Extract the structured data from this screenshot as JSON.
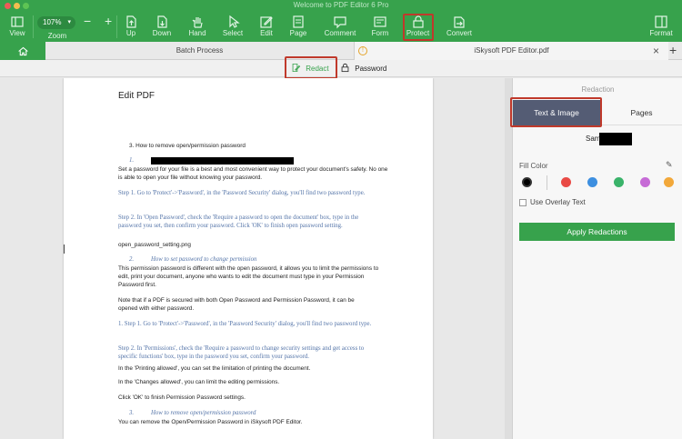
{
  "window": {
    "title": "Welcome to PDF Editor 6 Pro"
  },
  "toolbar": {
    "zoom_value": "107%",
    "zoom_minus": "−",
    "zoom_plus": "+",
    "items": [
      {
        "label": "View",
        "icon": "sidebar-icon"
      },
      {
        "label": "Zoom",
        "icon": "zoom-icon"
      },
      {
        "label": "Up",
        "icon": "page-up-icon"
      },
      {
        "label": "Down",
        "icon": "page-down-icon"
      },
      {
        "label": "Hand",
        "icon": "hand-icon"
      },
      {
        "label": "Select",
        "icon": "cursor-icon"
      },
      {
        "label": "Edit",
        "icon": "edit-icon"
      },
      {
        "label": "Page",
        "icon": "page-icon"
      },
      {
        "label": "Comment",
        "icon": "comment-icon"
      },
      {
        "label": "Form",
        "icon": "form-icon"
      },
      {
        "label": "Protect",
        "icon": "protect-icon"
      },
      {
        "label": "Convert",
        "icon": "convert-icon"
      },
      {
        "label": "Format",
        "icon": "format-icon"
      }
    ],
    "active": "Protect"
  },
  "tabs": {
    "batch": "Batch Process",
    "file": "iSkysoft PDF Editor.pdf",
    "warn": "!",
    "close": "×",
    "add": "+"
  },
  "subtoolbar": {
    "redact": "Redact",
    "password": "Password"
  },
  "document": {
    "heading": "Edit PDF",
    "list_item": "3.    How to remove open/permission password",
    "num1": "1.",
    "p1": "Set a password for your file is a best and most convenient way to protect your document's safety. No one is able to open your file without knowing your password.",
    "s1": "Step 1. Go to 'Protect'->'Password', in the 'Password Security' dialog, you'll find two password type.",
    "s2": "Step 2. In 'Open Password', check the 'Require a password to open the document' box, type in the password you set, then confirm your password. Click 'OK' to finish open password setting.",
    "img": "open_password_setting.png",
    "num2": "2.",
    "h2": "How to set password to change permission",
    "p2": "This permission password is different with the open password, it allows you to limit the permissions to edit, print your document, anyone who wants to edit the document must type in your Permission Password first.",
    "p3": "Note that if a PDF is secured with both Open Password and Permission Password, it can be opened with either password.",
    "s3": "1. Step 1. Go to 'Protect'->'Password', in the 'Password Security' dialog, you'll find two password type.",
    "s4": "Step 2. In 'Permissions', check the 'Require a password to change security settings and get access to specific functions' box, type in the password you set, confirm your password.",
    "p4": "In the 'Printing allowed', you can set the limitation of printing the document.",
    "p5": "In the 'Changes allowed', you can limit the editing permissions.",
    "p6": "Click 'OK' to finish Permission Password settings.",
    "num3": "3.",
    "h3": "How to remove open/permission password",
    "p7": "You can remove the Open/Permission Password in iSkysoft PDF Editor."
  },
  "panel": {
    "title": "Redaction",
    "tab_text_image": "Text & Image",
    "tab_pages": "Pages",
    "sample": "Sam",
    "fill_color_label": "Fill Color",
    "colors": [
      "#000000",
      "#e94a45",
      "#3d8fe0",
      "#3ab36a",
      "#c66bd6",
      "#f2a83a"
    ],
    "overlay_label": "Use Overlay Text",
    "apply_label": "Apply Redactions"
  }
}
